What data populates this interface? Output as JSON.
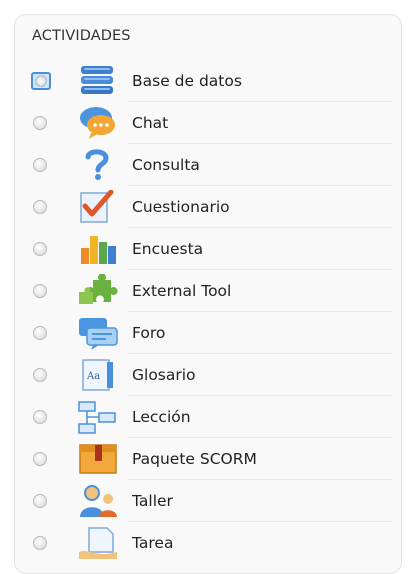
{
  "section": {
    "title": "ACTIVIDADES"
  },
  "activities": [
    {
      "label": "Base de datos",
      "icon": "database-icon",
      "selected": true
    },
    {
      "label": "Chat",
      "icon": "chat-bubble-icon",
      "selected": false
    },
    {
      "label": "Consulta",
      "icon": "question-mark-icon",
      "selected": false
    },
    {
      "label": "Cuestionario",
      "icon": "checkmark-document-icon",
      "selected": false
    },
    {
      "label": "Encuesta",
      "icon": "bar-chart-icon",
      "selected": false
    },
    {
      "label": "External Tool",
      "icon": "puzzle-piece-icon",
      "selected": false
    },
    {
      "label": "Foro",
      "icon": "forum-bubbles-icon",
      "selected": false
    },
    {
      "label": "Glosario",
      "icon": "glossary-book-icon",
      "selected": false
    },
    {
      "label": "Lección",
      "icon": "flowchart-icon",
      "selected": false
    },
    {
      "label": "Paquete SCORM",
      "icon": "package-box-icon",
      "selected": false
    },
    {
      "label": "Taller",
      "icon": "workshop-people-icon",
      "selected": false
    },
    {
      "label": "Tarea",
      "icon": "assignment-hand-icon",
      "selected": false
    }
  ],
  "colors": {
    "selected_radio_border": "#4a90d9",
    "panel_background": "#f9f9f9"
  }
}
